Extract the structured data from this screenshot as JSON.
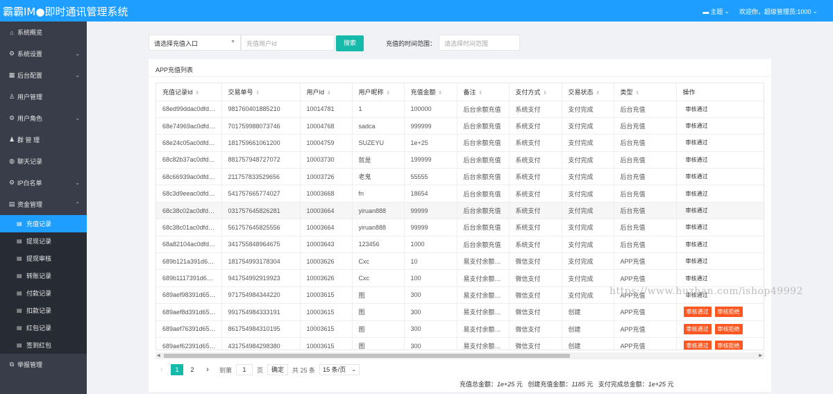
{
  "header": {
    "title": "霸霸IM●即时通讯管理系统",
    "theme_label": "主题",
    "welcome": "欢迎你，超级管理员:1000"
  },
  "sidebar": {
    "items": [
      {
        "label": "系统概览",
        "icon": "home-icon"
      },
      {
        "label": "系统设置",
        "icon": "gear-icon",
        "expandable": true
      },
      {
        "label": "后台配置",
        "icon": "calendar-icon",
        "expandable": true
      },
      {
        "label": "用户管理",
        "icon": "user-icon"
      },
      {
        "label": "用户角色",
        "icon": "gear-icon",
        "expandable": true
      },
      {
        "label": "群 管 理",
        "icon": "group-icon"
      },
      {
        "label": "聊天记录",
        "icon": "chat-icon"
      },
      {
        "label": "IP白名单",
        "icon": "gear-icon",
        "expandable": true
      },
      {
        "label": "资金管理",
        "icon": "wallet-icon",
        "expandable": true,
        "expanded": true
      }
    ],
    "sub_items": [
      {
        "label": "充值记录",
        "active": true
      },
      {
        "label": "提现记录"
      },
      {
        "label": "提现审核"
      },
      {
        "label": "转账记录"
      },
      {
        "label": "付款记录"
      },
      {
        "label": "扣款记录"
      },
      {
        "label": "红包记录"
      },
      {
        "label": "签到红包"
      }
    ],
    "bottom_item": {
      "label": "举报管理",
      "icon": "report-icon"
    }
  },
  "filter": {
    "select_value": "请选择充值入口",
    "user_id_placeholder": "充值用户Id",
    "search_label": "搜索",
    "range_label": "充值的时间范围：",
    "range_placeholder": "请选择时间范围"
  },
  "panel": {
    "title": "APP充值列表"
  },
  "table": {
    "columns": [
      "充值记录Id",
      "交易单号",
      "用户Id",
      "用户昵称",
      "充值金额",
      "备注",
      "支付方式",
      "交易状态",
      "类型",
      "操作"
    ],
    "rows": [
      [
        "68ed99ddac0dfd…",
        "981760401885210",
        "10014781",
        "1",
        "100000",
        "后台余额充值",
        "系统支付",
        "支付完成",
        "后台充值",
        "审核通过"
      ],
      [
        "68e74969ac0dfd…",
        "701759988073746",
        "10004768",
        "sadca",
        "999999",
        "后台余额充值",
        "系统支付",
        "支付完成",
        "后台充值",
        "审核通过"
      ],
      [
        "68e24c05ac0dfd…",
        "181759661061200",
        "10004759",
        "SUZEYU",
        "1e+25",
        "后台余额充值",
        "系统支付",
        "支付完成",
        "后台充值",
        "审核通过"
      ],
      [
        "68c82b37ac0dfd…",
        "881757948727072",
        "10003730",
        "就是",
        "199999",
        "后台余额充值",
        "系统支付",
        "支付完成",
        "后台充值",
        "审核通过"
      ],
      [
        "68c66939ac0dfd…",
        "211757833529656",
        "10003726",
        "老鬼",
        "55555",
        "后台余额充值",
        "系统支付",
        "支付完成",
        "后台充值",
        "审核通过"
      ],
      [
        "68c3d9eeac0dfd…",
        "541757665774027",
        "10003668",
        "fn",
        "18654",
        "后台余额充值",
        "系统支付",
        "支付完成",
        "后台充值",
        "审核通过"
      ],
      [
        "68c38c02ac0dfd…",
        "031757645826281",
        "10003664",
        "yiruan888",
        "99999",
        "后台余额充值",
        "系统支付",
        "支付完成",
        "后台充值",
        "审核通过"
      ],
      [
        "68c38c01ac0dfd…",
        "561757645825556",
        "10003664",
        "yiruan888",
        "99999",
        "后台余额充值",
        "系统支付",
        "支付完成",
        "后台充值",
        "审核通过"
      ],
      [
        "68a82104ac0dfd…",
        "341755848964675",
        "10003643",
        "123456",
        "1000",
        "后台余额充值",
        "系统支付",
        "支付完成",
        "后台充值",
        "审核通过"
      ],
      [
        "689b121a391d6…",
        "181754993178304",
        "10003626",
        "Cxc",
        "10",
        "易支付余额…",
        "微信支付",
        "支付完成",
        "APP充值",
        "审核通过"
      ],
      [
        "689b1117391d6…",
        "941754992919923",
        "10003626",
        "Cxc",
        "100",
        "易支付余额…",
        "微信支付",
        "支付完成",
        "APP充值",
        "审核通过"
      ],
      [
        "689aef98391d65…",
        "971754984344220",
        "10003615",
        "图",
        "300",
        "易支付余额…",
        "微信支付",
        "支付完成",
        "APP充值",
        "审核通过"
      ],
      [
        "689aef8d391d65…",
        "991754984333191",
        "10003615",
        "图",
        "300",
        "易支付余额…",
        "微信支付",
        "创建",
        "APP充值",
        "审核通过|审核拒绝"
      ],
      [
        "689aef76391d65…",
        "861754984310195",
        "10003615",
        "图",
        "300",
        "易支付余额…",
        "微信支付",
        "创建",
        "APP充值",
        "审核通过|审核拒绝"
      ],
      [
        "689aef62391d65…",
        "431754984298380",
        "10003615",
        "图",
        "300",
        "易支付余额…",
        "微信支付",
        "创建",
        "APP充值",
        "审核通过|审核拒绝"
      ]
    ],
    "hover_row": 6
  },
  "pager": {
    "pages": [
      "1",
      "2"
    ],
    "current": "1",
    "goto_label": "到第",
    "goto_value": "1",
    "page_unit": "页",
    "confirm_label": "确定",
    "total_label": "共 25 条",
    "page_size": "15 条/页"
  },
  "summary": {
    "total_label": "充值总金额：",
    "total_value": "1e+25",
    "admin_label": "创建充值金额：",
    "admin_value": "1185",
    "paid_label": "支付完成总金额：",
    "paid_value": "1e+25",
    "unit": "元"
  },
  "watermark": "https://www.huzhan.com/ishop49992",
  "colors": {
    "header": "#1e9fff",
    "sidebar": "#393d49",
    "primary_button": "#16baaa",
    "danger_button": "#ff5722"
  }
}
